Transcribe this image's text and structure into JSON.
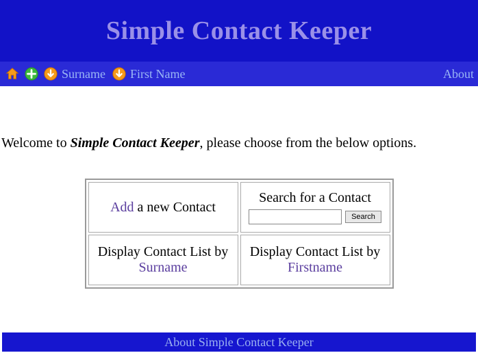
{
  "header": {
    "title": "Simple Contact Keeper"
  },
  "nav": {
    "surname": "Surname",
    "firstname": "First Name",
    "about": "About"
  },
  "welcome": {
    "greeting": "Welcome",
    "to": " to ",
    "appname": "Simple Contact Keeper",
    "rest": ", please choose from the below options."
  },
  "options": {
    "add_link": "Add",
    "add_rest": " a new Contact",
    "search_title": "Search for a Contact",
    "search_button": "Search",
    "display_surname_pre": "Display Contact List by ",
    "display_surname_link": "Surname",
    "display_firstname_pre": "Display Contact List by ",
    "display_firstname_link": "Firstname"
  },
  "footer": {
    "text": "About Simple Contact Keeper"
  }
}
